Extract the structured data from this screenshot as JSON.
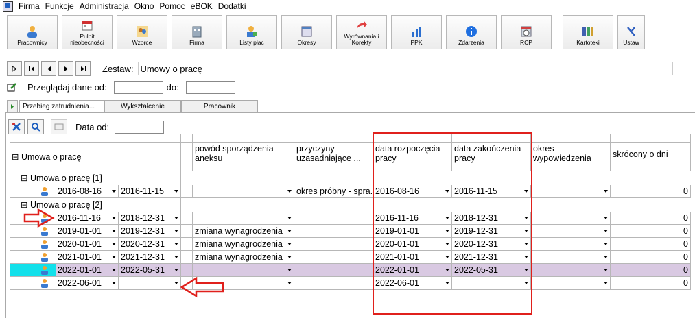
{
  "menu": [
    "Firma",
    "Funkcje",
    "Administracja",
    "Okno",
    "Pomoc",
    "eBOK",
    "Dodatki"
  ],
  "toolbar": [
    {
      "label": "Pracownicy",
      "icon": "person-icon"
    },
    {
      "label": "Pulpit nieobecności",
      "icon": "calendar-icon"
    },
    {
      "label": "Wzorce",
      "icon": "people-icon"
    },
    {
      "label": "Firma",
      "icon": "building-icon"
    },
    {
      "label": "Listy płac",
      "icon": "payroll-icon"
    },
    {
      "label": "Okresy",
      "icon": "window-icon"
    },
    {
      "label": "Wyrównania i Korekty",
      "icon": "arrow-icon"
    },
    {
      "label": "PPK",
      "icon": "bar-chart-icon"
    },
    {
      "label": "Zdarzenia",
      "icon": "info-icon"
    },
    {
      "label": "RCP",
      "icon": "clock-icon"
    },
    {
      "label": "Kartoteki",
      "icon": "cards-icon"
    },
    {
      "label": "Ustaw",
      "icon": "settings-icon"
    }
  ],
  "nav": {
    "zestaw_label": "Zestaw:",
    "zestaw_value": "Umowy o pracę"
  },
  "przegladaj": {
    "label": "Przeglądaj dane od:",
    "do_label": "do:"
  },
  "tabs": [
    "Przebieg zatrudnienia...",
    "Wykształcenie",
    "Pracownik"
  ],
  "subtoolbar": {
    "data_od_label": "Data od:"
  },
  "grid": {
    "group_header": "Umowa o pracę",
    "columns": [
      "powód sporządzenia aneksu",
      "przyczyny uzasadniające ...",
      "data rozpoczęcia pracy",
      "data zakończenia pracy",
      "okres wypowiedzenia",
      "skrócony o dni"
    ],
    "groups": [
      {
        "title": "Umowa o pracę [1]",
        "rows": [
          {
            "from": "2016-08-16",
            "to": "2016-11-15",
            "powod": "",
            "przyczyny": "okres próbny - spra...",
            "start": "2016-08-16",
            "end": "2016-11-15",
            "okres": "",
            "skrocony": "0",
            "selected": false
          }
        ]
      },
      {
        "title": "Umowa o pracę [2]",
        "rows": [
          {
            "from": "2016-11-16",
            "to": "2018-12-31",
            "powod": "",
            "przyczyny": "",
            "start": "2016-11-16",
            "end": "2018-12-31",
            "okres": "",
            "skrocony": "0",
            "selected": false
          },
          {
            "from": "2019-01-01",
            "to": "2019-12-31",
            "powod": "zmiana wynagrodzenia",
            "przyczyny": "",
            "start": "2019-01-01",
            "end": "2019-12-31",
            "okres": "",
            "skrocony": "0",
            "selected": false
          },
          {
            "from": "2020-01-01",
            "to": "2020-12-31",
            "powod": "zmiana wynagrodzenia",
            "przyczyny": "",
            "start": "2020-01-01",
            "end": "2020-12-31",
            "okres": "",
            "skrocony": "0",
            "selected": false
          },
          {
            "from": "2021-01-01",
            "to": "2021-12-31",
            "powod": "zmiana wynagrodzenia",
            "przyczyny": "",
            "start": "2021-01-01",
            "end": "2021-12-31",
            "okres": "",
            "skrocony": "0",
            "selected": false
          },
          {
            "from": "2022-01-01",
            "to": "2022-05-31",
            "powod": "",
            "przyczyny": "",
            "start": "2022-01-01",
            "end": "2022-05-31",
            "okres": "",
            "skrocony": "0",
            "selected": true
          },
          {
            "from": "2022-06-01",
            "to": "",
            "powod": "",
            "przyczyny": "",
            "start": "2022-06-01",
            "end": "",
            "okres": "",
            "skrocony": "0",
            "selected": false
          }
        ]
      }
    ]
  },
  "colors": {
    "selected_row": "#d9c9e2",
    "selected_icon_cell": "#12e0ea",
    "annotation_red": "#e0201c"
  }
}
